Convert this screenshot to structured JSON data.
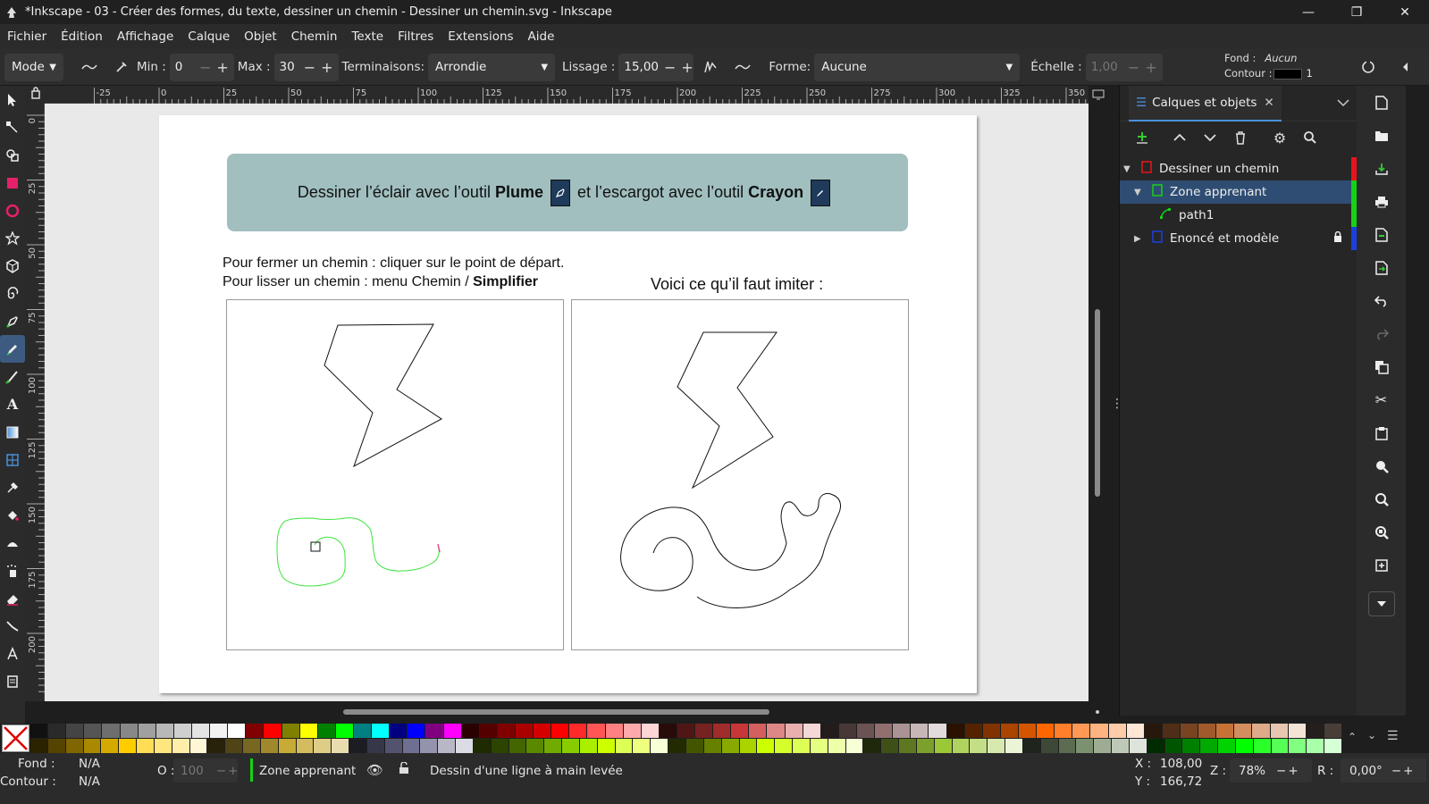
{
  "window": {
    "title": "*Inkscape - 03 - Créer des formes, du texte, dessiner un chemin - Dessiner un chemin.svg - Inkscape",
    "minimize_icon": "minimize-icon",
    "maximize_icon": "restore-icon",
    "close_icon": "close-icon"
  },
  "menu": [
    "Fichier",
    "Édition",
    "Affichage",
    "Calque",
    "Objet",
    "Chemin",
    "Texte",
    "Filtres",
    "Extensions",
    "Aide"
  ],
  "toolbar": {
    "mode_label": "Mode",
    "min_label": "Min :",
    "min_value": "0",
    "max_label": "Max :",
    "max_value": "30",
    "caps_label": "Terminaisons:",
    "caps_value": "Arrondie",
    "smoothing_label": "Lissage :",
    "smoothing_value": "15,00",
    "shape_label": "Forme:",
    "shape_value": "Aucune",
    "scale_label": "Échelle :",
    "scale_value": "1,00",
    "fill_label": "Fond :",
    "fill_value": "Aucun",
    "stroke_label": "Contour :",
    "stroke_width": "1",
    "stroke_color": "#000000"
  },
  "ruler": {
    "h_ticks": [
      "-25",
      "0",
      "25",
      "50",
      "75",
      "100",
      "125",
      "150",
      "175",
      "200",
      "225",
      "250",
      "275",
      "300",
      "325",
      "350"
    ],
    "v_ticks": [
      "0",
      "25",
      "50",
      "75",
      "100",
      "125",
      "150",
      "175",
      "200"
    ]
  },
  "document": {
    "banner_pre": "Dessiner l’éclair avec l’outil",
    "banner_tool1": "Plume",
    "banner_mid": "et l’escargot avec l’outil",
    "banner_tool2": "Crayon",
    "instruction1": "Pour fermer un chemin : cliquer sur le point de départ.",
    "instruction2_pre": "Pour lisser un chemin : menu Chemin /",
    "instruction2_bold": "Simplifier",
    "model_caption": "Voici ce qu’il faut imiter :"
  },
  "panel": {
    "tab_label": "Calques et objets",
    "items": [
      {
        "label": "Dessiner un chemin",
        "color": "#e8141b"
      },
      {
        "label": "Zone apprenant",
        "color": "#16d116"
      },
      {
        "label": "path1",
        "color": "#16d116"
      },
      {
        "label": "Enoncé et modèle",
        "color": "#1d3fe0"
      }
    ]
  },
  "status": {
    "fill_label": "Fond :",
    "fill_value": "N/A",
    "stroke_label": "Contour :",
    "stroke_value": "N/A",
    "opacity_label": "O :",
    "opacity_value": "100",
    "layer_name": "Zone apprenant",
    "message": "Dessin d'une ligne à main levée",
    "x_label": "X :",
    "x_value": "108,00",
    "y_label": "Y :",
    "y_value": "166,72",
    "zoom_label": "Z :",
    "zoom_value": "78%",
    "rotate_label": "R :",
    "rotate_value": "0,00°"
  },
  "colors": {
    "accent": "#4a90d9",
    "selection": "#2f4d73",
    "banner_bg": "#a1bfbf",
    "user_path": "#3ce33c"
  }
}
